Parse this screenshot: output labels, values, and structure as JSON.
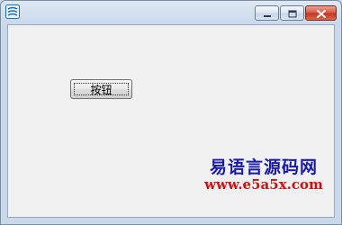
{
  "window": {
    "title": "",
    "icon": "app-icon"
  },
  "caption_buttons": {
    "minimize": "minimize-icon",
    "maximize": "maximize-icon",
    "close": "close-icon"
  },
  "form": {
    "button_label": "按钮"
  },
  "watermark": {
    "title": "易语言源码网",
    "url": "www.e5a5x.com"
  },
  "colors": {
    "titlebar": "#cfdbe8",
    "client_bg": "#f0f0f0",
    "close_button": "#c9462e",
    "watermark_title": "#1a1aa6",
    "watermark_url": "#cc1111"
  }
}
